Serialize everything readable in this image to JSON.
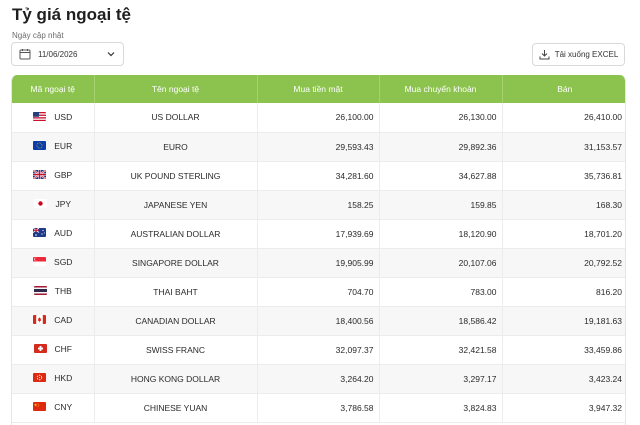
{
  "page": {
    "title": "Tỷ giá ngoại tệ",
    "date_label": "Ngày cập nhật"
  },
  "date_picker": {
    "value": "11/06/2026"
  },
  "excel_button": {
    "label": "Tải xuống EXCEL"
  },
  "table": {
    "headers": [
      "Mã ngoại tệ",
      "Tên ngoại tệ",
      "Mua tiền mặt",
      "Mua chuyển khoản",
      "Bán"
    ],
    "rows": [
      {
        "flag": "us-flag-icon",
        "code": "USD",
        "name": "US DOLLAR",
        "cash": "26,100.00",
        "transfer": "26,130.00",
        "sell": "26,410.00"
      },
      {
        "flag": "eu-flag-icon",
        "code": "EUR",
        "name": "EURO",
        "cash": "29,593.43",
        "transfer": "29,892.36",
        "sell": "31,153.57"
      },
      {
        "flag": "gb-flag-icon",
        "code": "GBP",
        "name": "UK POUND STERLING",
        "cash": "34,281.60",
        "transfer": "34,627.88",
        "sell": "35,736.81"
      },
      {
        "flag": "jp-flag-icon",
        "code": "JPY",
        "name": "JAPANESE YEN",
        "cash": "158.25",
        "transfer": "159.85",
        "sell": "168.30"
      },
      {
        "flag": "au-flag-icon",
        "code": "AUD",
        "name": "AUSTRALIAN DOLLAR",
        "cash": "17,939.69",
        "transfer": "18,120.90",
        "sell": "18,701.20"
      },
      {
        "flag": "sg-flag-icon",
        "code": "SGD",
        "name": "SINGAPORE DOLLAR",
        "cash": "19,905.99",
        "transfer": "20,107.06",
        "sell": "20,792.52"
      },
      {
        "flag": "th-flag-icon",
        "code": "THB",
        "name": "THAI BAHT",
        "cash": "704.70",
        "transfer": "783.00",
        "sell": "816.20"
      },
      {
        "flag": "ca-flag-icon",
        "code": "CAD",
        "name": "CANADIAN DOLLAR",
        "cash": "18,400.56",
        "transfer": "18,586.42",
        "sell": "19,181.63"
      },
      {
        "flag": "ch-flag-icon",
        "code": "CHF",
        "name": "SWISS FRANC",
        "cash": "32,097.37",
        "transfer": "32,421.58",
        "sell": "33,459.86"
      },
      {
        "flag": "hk-flag-icon",
        "code": "HKD",
        "name": "HONG KONG DOLLAR",
        "cash": "3,264.20",
        "transfer": "3,297.17",
        "sell": "3,423.24"
      },
      {
        "flag": "cn-flag-icon",
        "code": "CNY",
        "name": "CHINESE YUAN",
        "cash": "3,786.58",
        "transfer": "3,824.83",
        "sell": "3,947.32"
      }
    ]
  },
  "colors": {
    "header_bg": "#8cc34e",
    "header_text": "#ffffff",
    "stripe": "#f7f7f7"
  }
}
